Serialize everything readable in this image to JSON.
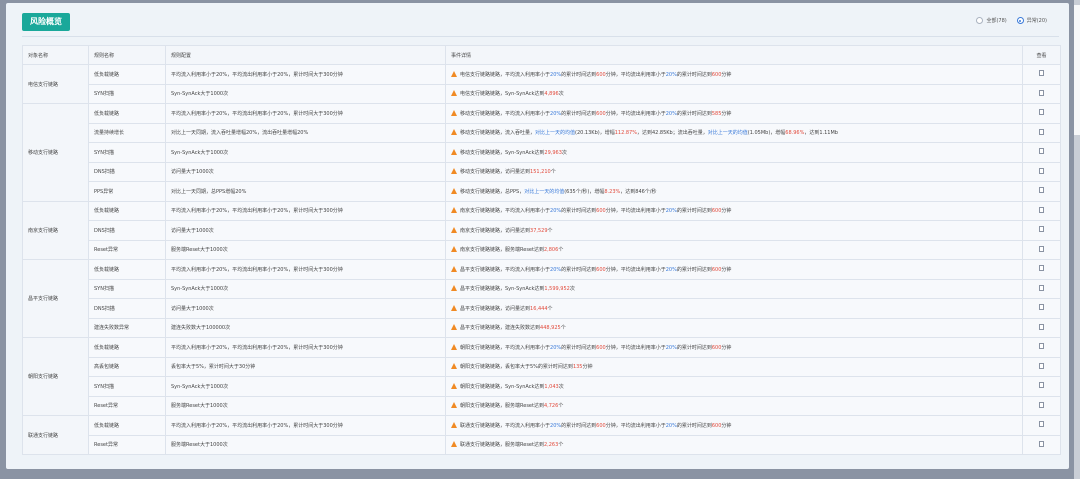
{
  "toolbar": {
    "risk_button": "风险概览",
    "radio_all": "全部(78)",
    "radio_abnormal": "异常(20)"
  },
  "table": {
    "headers": [
      "对象名称",
      "规则名称",
      "规则配置",
      "事件详情",
      "查看"
    ],
    "groups": [
      {
        "object": "电信支行链路",
        "rows": [
          {
            "rule": "低负载链路",
            "config": "平均流入利用率小于20%，平均流出利用率小于20%，累计时间大于300分钟",
            "detail": [
              {
                "t": "电信支行链路链路，平均流入利用率小于"
              },
              {
                "t": "20%",
                "c": "blue"
              },
              {
                "t": "的累计时间达到"
              },
              {
                "t": "600",
                "c": "red"
              },
              {
                "t": "分钟，平均流出利用率小于"
              },
              {
                "t": "20%",
                "c": "blue"
              },
              {
                "t": "的累计时间达到"
              },
              {
                "t": "600",
                "c": "red"
              },
              {
                "t": "分钟"
              }
            ]
          },
          {
            "rule": "SYN扫描",
            "config": "Syn-SynAck大于1000次",
            "detail": [
              {
                "t": "电信支行链路链路，Syn-SynAck达到"
              },
              {
                "t": "4,896",
                "c": "red"
              },
              {
                "t": "次"
              }
            ]
          }
        ]
      },
      {
        "object": "移动支行链路",
        "rows": [
          {
            "rule": "低负载链路",
            "config": "平均流入利用率小于20%，平均流出利用率小于20%，累计时间大于300分钟",
            "detail": [
              {
                "t": "移动支行链路链路，平均流入利用率小于"
              },
              {
                "t": "20%",
                "c": "blue"
              },
              {
                "t": "的累计时间达到"
              },
              {
                "t": "600",
                "c": "red"
              },
              {
                "t": "分钟，平均流出利用率小于"
              },
              {
                "t": "20%",
                "c": "blue"
              },
              {
                "t": "的累计时间达到"
              },
              {
                "t": "585",
                "c": "red"
              },
              {
                "t": "分钟"
              }
            ]
          },
          {
            "rule": "流量持续增长",
            "config": "对比上一天同期，流入吞吐量增幅20%，流出吞吐量增幅20%",
            "detail": [
              {
                "t": "移动支行链路链路，流入吞吐量，"
              },
              {
                "t": "对比上一天的均值",
                "c": "blue"
              },
              {
                "t": "(20.13Kb)，增幅"
              },
              {
                "t": "112.87%",
                "c": "red"
              },
              {
                "t": "，达到42.85Kb；流出吞吐量，"
              },
              {
                "t": "对比上一天的均值",
                "c": "blue"
              },
              {
                "t": "(1.05Mb)，增幅"
              },
              {
                "t": "68.96%",
                "c": "red"
              },
              {
                "t": "，达到1.11Mb"
              }
            ]
          },
          {
            "rule": "SYN扫描",
            "config": "Syn-SynAck大于1000次",
            "detail": [
              {
                "t": "移动支行链路链路，Syn-SynAck达到"
              },
              {
                "t": "29,963",
                "c": "red"
              },
              {
                "t": "次"
              }
            ]
          },
          {
            "rule": "DNS扫描",
            "config": "访问量大于1000次",
            "detail": [
              {
                "t": "移动支行链路链路，访问量达到"
              },
              {
                "t": "151,210",
                "c": "red"
              },
              {
                "t": "个"
              }
            ]
          },
          {
            "rule": "PPS异常",
            "config": "对比上一天同期，总PPS增幅20%",
            "detail": [
              {
                "t": "移动支行链路链路，总PPS，"
              },
              {
                "t": "对比上一天的均值",
                "c": "blue"
              },
              {
                "t": "(635个/秒)，增幅"
              },
              {
                "t": "8.23%",
                "c": "red"
              },
              {
                "t": "，达到846个/秒"
              }
            ]
          }
        ]
      },
      {
        "object": "南京支行链路",
        "rows": [
          {
            "rule": "低负载链路",
            "config": "平均流入利用率小于20%，平均流出利用率小于20%，累计时间大于300分钟",
            "detail": [
              {
                "t": "南京支行链路链路，平均流入利用率小于"
              },
              {
                "t": "20%",
                "c": "blue"
              },
              {
                "t": "的累计时间达到"
              },
              {
                "t": "600",
                "c": "red"
              },
              {
                "t": "分钟，平均流出利用率小于"
              },
              {
                "t": "20%",
                "c": "blue"
              },
              {
                "t": "的累计时间达到"
              },
              {
                "t": "600",
                "c": "red"
              },
              {
                "t": "分钟"
              }
            ]
          },
          {
            "rule": "DNS扫描",
            "config": "访问量大于1000次",
            "detail": [
              {
                "t": "南京支行链路链路，访问量达到"
              },
              {
                "t": "37,529",
                "c": "red"
              },
              {
                "t": "个"
              }
            ]
          },
          {
            "rule": "Reset异常",
            "config": "服务端Reset大于1000次",
            "detail": [
              {
                "t": "南京支行链路链路，服务端Reset达到"
              },
              {
                "t": "2,806",
                "c": "red"
              },
              {
                "t": "个"
              }
            ]
          }
        ]
      },
      {
        "object": "昌平支行链路",
        "rows": [
          {
            "rule": "低负载链路",
            "config": "平均流入利用率小于20%，平均流出利用率小于20%，累计时间大于300分钟",
            "detail": [
              {
                "t": "昌平支行链路链路，平均流入利用率小于"
              },
              {
                "t": "20%",
                "c": "blue"
              },
              {
                "t": "的累计时间达到"
              },
              {
                "t": "600",
                "c": "red"
              },
              {
                "t": "分钟，平均流出利用率小于"
              },
              {
                "t": "20%",
                "c": "blue"
              },
              {
                "t": "的累计时间达到"
              },
              {
                "t": "600",
                "c": "red"
              },
              {
                "t": "分钟"
              }
            ]
          },
          {
            "rule": "SYN扫描",
            "config": "Syn-SynAck大于1000次",
            "detail": [
              {
                "t": "昌平支行链路链路，Syn-SynAck达到"
              },
              {
                "t": "1,599,952",
                "c": "red"
              },
              {
                "t": "次"
              }
            ]
          },
          {
            "rule": "DNS扫描",
            "config": "访问量大于1000次",
            "detail": [
              {
                "t": "昌平支行链路链路，访问量达到"
              },
              {
                "t": "16,444",
                "c": "red"
              },
              {
                "t": "个"
              }
            ]
          },
          {
            "rule": "建连失败数异常",
            "config": "建连失败数大于100000次",
            "detail": [
              {
                "t": "昌平支行链路链路，建连失败数达到"
              },
              {
                "t": "448,925",
                "c": "red"
              },
              {
                "t": "个"
              }
            ]
          }
        ]
      },
      {
        "object": "朝阳支行链路",
        "rows": [
          {
            "rule": "低负载链路",
            "config": "平均流入利用率小于20%，平均流出利用率小于20%，累计时间大于300分钟",
            "detail": [
              {
                "t": "朝阳支行链路链路，平均流入利用率小于"
              },
              {
                "t": "20%",
                "c": "blue"
              },
              {
                "t": "的累计时间达到"
              },
              {
                "t": "600",
                "c": "red"
              },
              {
                "t": "分钟，平均流出利用率小于"
              },
              {
                "t": "20%",
                "c": "blue"
              },
              {
                "t": "的累计时间达到"
              },
              {
                "t": "600",
                "c": "red"
              },
              {
                "t": "分钟"
              }
            ]
          },
          {
            "rule": "高丢包链路",
            "config": "丢包率大于5%，累计时间大于30分钟",
            "detail": [
              {
                "t": "朝阳支行链路链路，丢包率大于5%的累计时间达到"
              },
              {
                "t": "135",
                "c": "red"
              },
              {
                "t": "分钟"
              }
            ]
          },
          {
            "rule": "SYN扫描",
            "config": "Syn-SynAck大于1000次",
            "detail": [
              {
                "t": "朝阳支行链路链路，Syn-SynAck达到"
              },
              {
                "t": "1,043",
                "c": "red"
              },
              {
                "t": "次"
              }
            ]
          },
          {
            "rule": "Reset异常",
            "config": "服务端Reset大于1000次",
            "detail": [
              {
                "t": "朝阳支行链路链路，服务端Reset达到"
              },
              {
                "t": "4,726",
                "c": "red"
              },
              {
                "t": "个"
              }
            ]
          }
        ]
      },
      {
        "object": "联通支行链路",
        "rows": [
          {
            "rule": "低负载链路",
            "config": "平均流入利用率小于20%，平均流出利用率小于20%，累计时间大于300分钟",
            "detail": [
              {
                "t": "联通支行链路链路，平均流入利用率小于"
              },
              {
                "t": "20%",
                "c": "blue"
              },
              {
                "t": "的累计时间达到"
              },
              {
                "t": "600",
                "c": "red"
              },
              {
                "t": "分钟，平均流出利用率小于"
              },
              {
                "t": "20%",
                "c": "blue"
              },
              {
                "t": "的累计时间达到"
              },
              {
                "t": "600",
                "c": "red"
              },
              {
                "t": "分钟"
              }
            ]
          },
          {
            "rule": "Reset异常",
            "config": "服务端Reset大于1000次",
            "detail": [
              {
                "t": "联通支行链路链路，服务端Reset达到"
              },
              {
                "t": "2,263",
                "c": "red"
              },
              {
                "t": "个"
              }
            ]
          }
        ]
      }
    ]
  },
  "icons": {
    "warning": "warning-icon",
    "view": "document-icon"
  },
  "colors": {
    "accent": "#1aa89a",
    "highlight_red": "#e24a3b",
    "highlight_blue": "#3a7ad9",
    "warning": "#f08a24"
  }
}
